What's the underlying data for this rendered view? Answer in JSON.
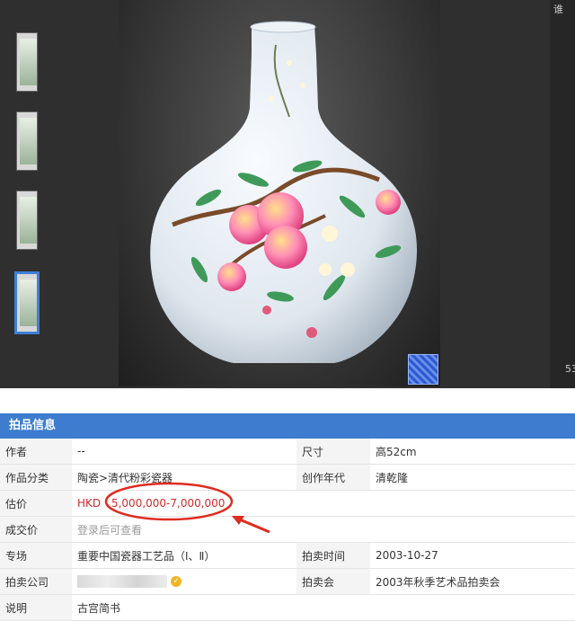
{
  "colors": {
    "accent": "#3d7ccf",
    "price_red": "#d62a2a",
    "annotation_red": "#e02b1f"
  },
  "viewer": {
    "thumb_strip_label": "谁",
    "thumb_caption": "53"
  },
  "info": {
    "header": "拍品信息",
    "rows": [
      {
        "label": "作者",
        "value": "--",
        "label2": "尺寸",
        "value2": "高52cm"
      },
      {
        "label": "作品分类",
        "value": "陶瓷>清代粉彩瓷器",
        "label2": "创作年代",
        "value2": "清乾隆"
      },
      {
        "label": "估价",
        "currency": "HKD",
        "value": "5,000,000-7,000,000",
        "label2": "",
        "value2": ""
      },
      {
        "label": "成交价",
        "value": "登录后可查看",
        "label2": "",
        "value2": ""
      },
      {
        "label": "专场",
        "value": "重要中国瓷器工艺品（Ⅰ、Ⅱ）",
        "label2": "拍卖时间",
        "value2": "2003-10-27"
      },
      {
        "label": "拍卖公司",
        "value": "",
        "badge_icon": "verified-badge-icon",
        "label2": "拍卖会",
        "value2": "2003年秋季艺术品拍卖会"
      },
      {
        "label": "说明",
        "value": "古宫简书"
      }
    ]
  }
}
